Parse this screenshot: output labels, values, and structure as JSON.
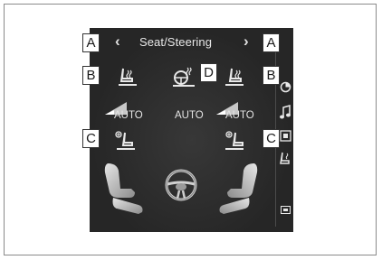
{
  "screen": {
    "title": "Seat/Steering",
    "prev_arrow": "‹",
    "next_arrow": "›",
    "auto_left": "AUTO",
    "auto_center": "AUTO",
    "auto_right": "AUTO"
  },
  "callouts": {
    "a_left": "A",
    "a_right": "A",
    "b_left": "B",
    "b_right": "B",
    "c_left": "C",
    "c_right": "C",
    "d": "D"
  },
  "icons": {
    "driver_seat_heater": "seat-heater-icon",
    "passenger_seat_heater": "seat-heater-icon",
    "steering_heater": "steering-heater-icon",
    "driver_seat_vent": "seat-ventilation-icon",
    "passenger_seat_vent": "seat-ventilation-icon",
    "driver_auto_level": "auto-level-icon",
    "passenger_auto_level": "auto-level-icon",
    "driver_seat_image": "driver-seat-image",
    "passenger_seat_image": "passenger-seat-image",
    "steering_wheel_image": "steering-wheel-image",
    "side_nav": [
      "climate-icon",
      "music-icon",
      "phone-icon",
      "seat-icon",
      "screen-icon"
    ]
  },
  "colors": {
    "screen_bg": "#262626",
    "icon": "#e8e8e8",
    "callout_bg": "#ffffff",
    "callout_border": "#333333"
  }
}
